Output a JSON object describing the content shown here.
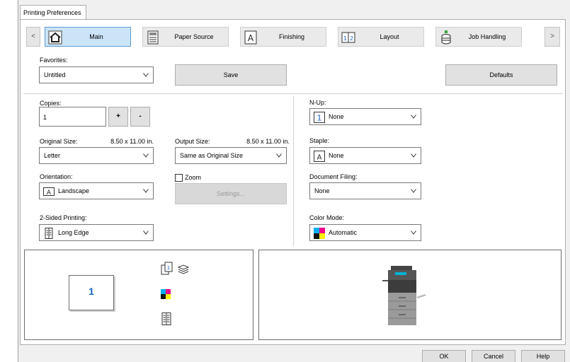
{
  "window": {
    "tab_label": "Printing Preferences"
  },
  "nav": {
    "prev_label": "<",
    "next_label": ">",
    "tabs": [
      {
        "label": "Main",
        "icon": "home-icon",
        "active": true
      },
      {
        "label": "Paper Source",
        "icon": "paper-source-icon",
        "active": false
      },
      {
        "label": "Finishing",
        "icon": "finishing-icon",
        "active": false
      },
      {
        "label": "Layout",
        "icon": "layout-icon",
        "active": false
      },
      {
        "label": "Job Handling",
        "icon": "job-handling-icon",
        "active": false
      }
    ]
  },
  "favorites": {
    "label": "Favorites:",
    "value": "Untitled",
    "save_label": "Save",
    "defaults_label": "Defaults"
  },
  "copies": {
    "label": "Copies:",
    "value": "1",
    "plus_label": "+",
    "minus_label": "-"
  },
  "original_size": {
    "label": "Original Size:",
    "dims": "8.50 x 11.00 in.",
    "value": "Letter"
  },
  "output_size": {
    "label": "Output Size:",
    "dims": "8.50 x 11.00 in.",
    "value": "Same as Original Size"
  },
  "zoom": {
    "label": "Zoom",
    "checked": false,
    "settings_label": "Settings..."
  },
  "orientation": {
    "label": "Orientation:",
    "value": "Landscape",
    "icon": "orientation-icon"
  },
  "two_sided": {
    "label": "2-Sided Printing:",
    "value": "Long Edge",
    "icon": "long-edge-icon"
  },
  "n_up": {
    "label": "N-Up:",
    "value": "None",
    "icon": "n-up-icon"
  },
  "staple": {
    "label": "Staple:",
    "value": "None",
    "icon": "staple-icon"
  },
  "document_filing": {
    "label": "Document Filing:",
    "value": "None"
  },
  "color_mode": {
    "label": "Color Mode:",
    "value": "Automatic",
    "icon": "color-mode-icon"
  },
  "preview": {
    "page_number": "1"
  },
  "footer": {
    "ok_label": "OK",
    "cancel_label": "Cancel",
    "help_label": "Help"
  },
  "colors": {
    "active_tab_bg": "#cce4f7",
    "active_tab_border": "#5b9bd5",
    "page_number": "#1565c0"
  }
}
